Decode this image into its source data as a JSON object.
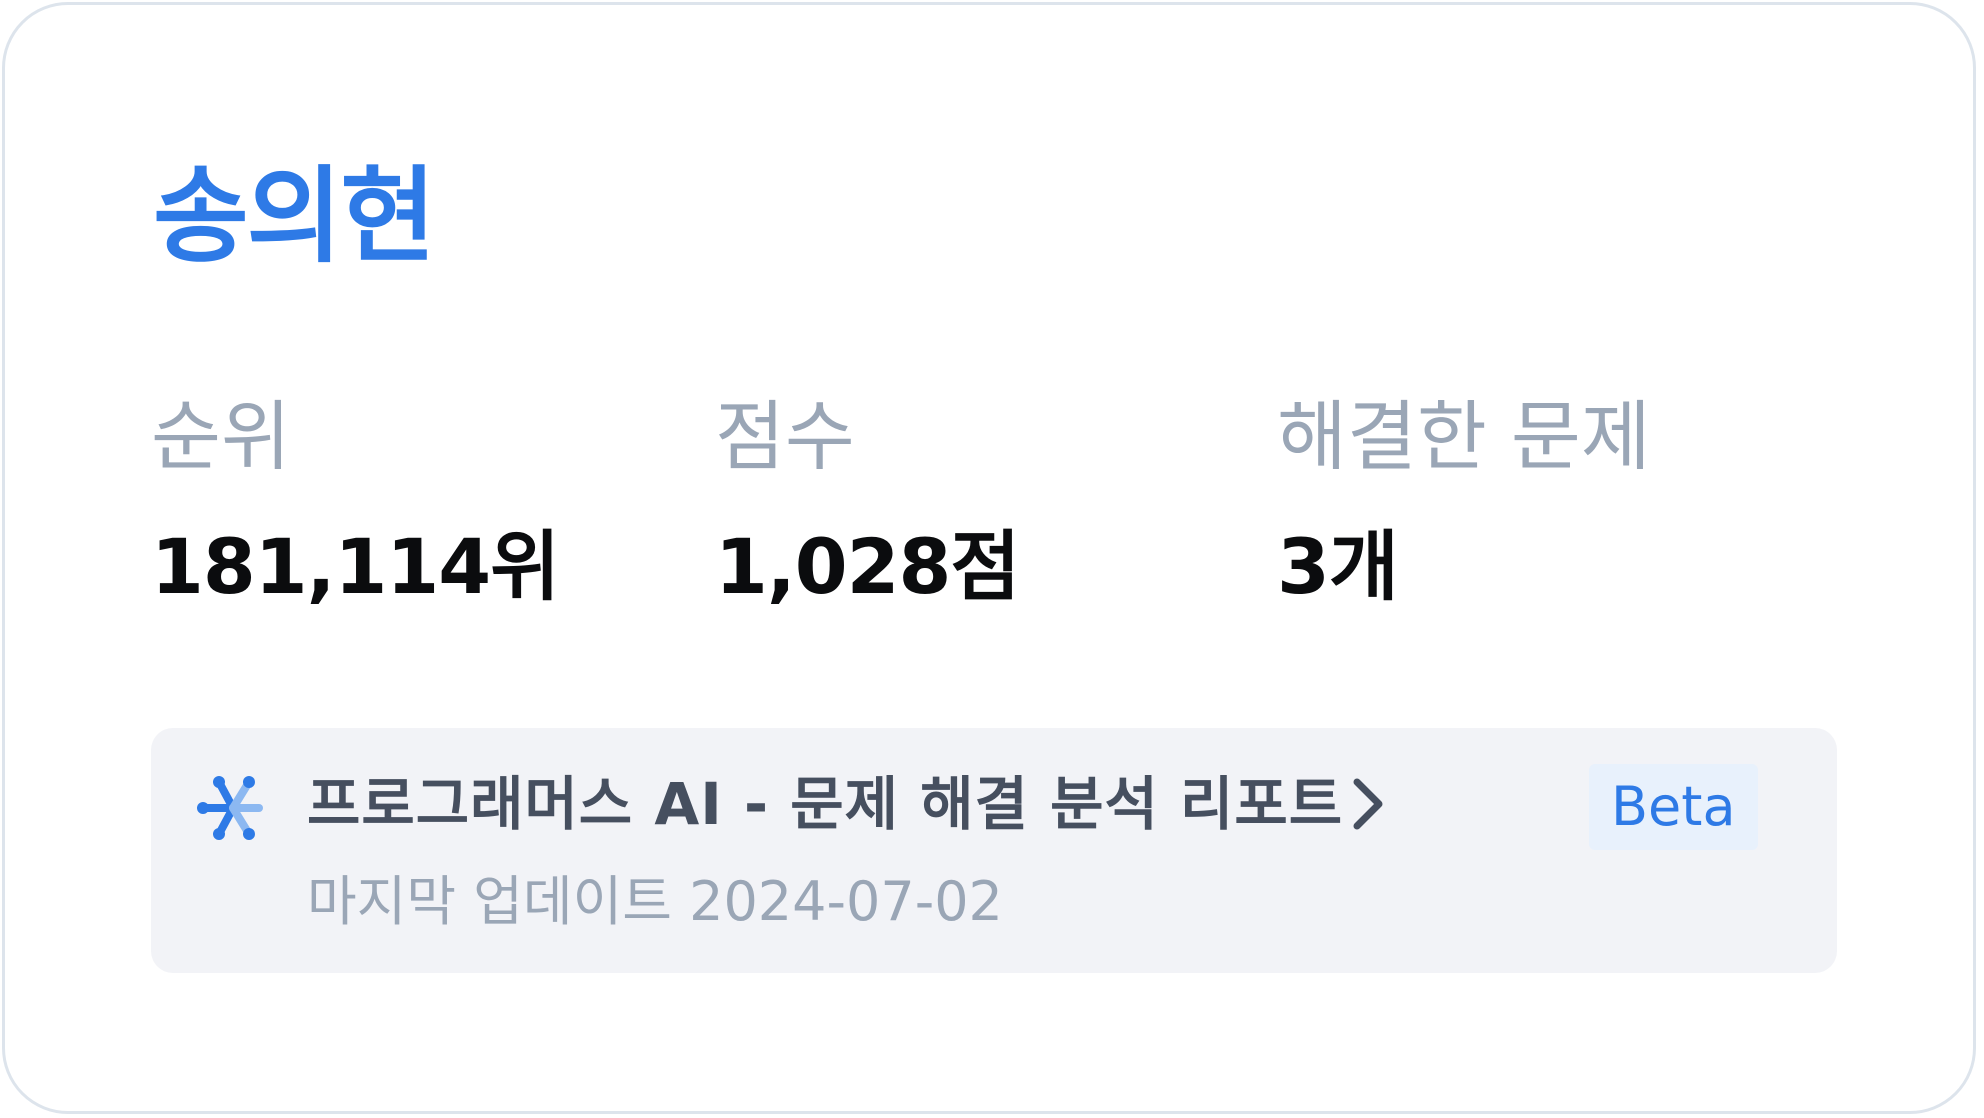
{
  "profile": {
    "name": "송의현"
  },
  "stats": {
    "rank": {
      "label": "순위",
      "value": "181,114위"
    },
    "score": {
      "label": "점수",
      "value": "1,028점"
    },
    "solved": {
      "label": "해결한 문제",
      "value": "3개"
    }
  },
  "report": {
    "icon": "ai-sparkle-icon",
    "title": "프로그래머스 AI - 문제 해결 분석 리포트",
    "badge": "Beta",
    "updated": "마지막 업데이트 2024-07-02"
  },
  "colors": {
    "accent": "#2e7ae6",
    "label": "#9aa6b6",
    "value": "#0b0c0e",
    "report_bg": "#f2f3f7",
    "badge_bg": "#e8f1fc",
    "card_border": "#dde4ec"
  }
}
